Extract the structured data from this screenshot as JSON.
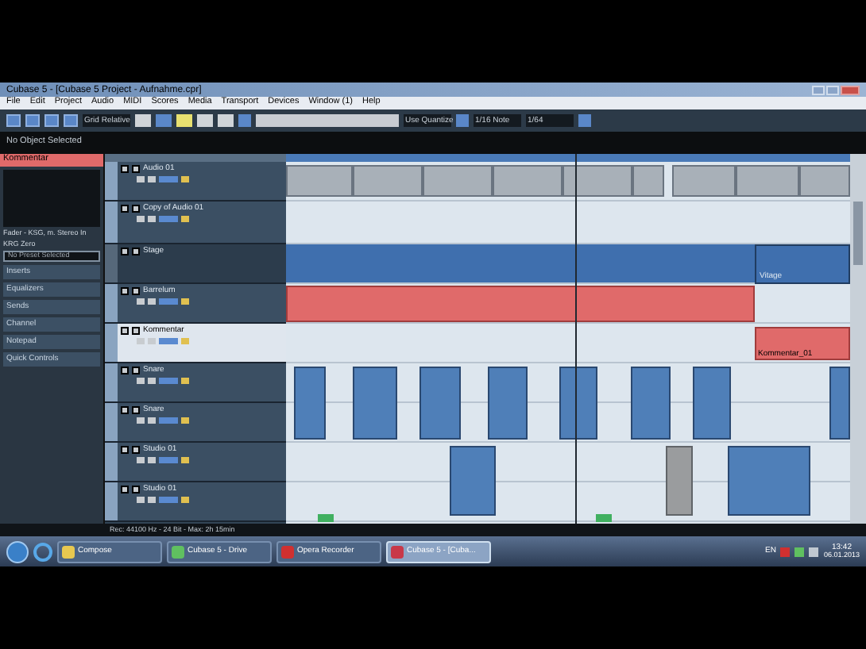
{
  "window": {
    "title": "Cubase 5 - [Cubase 5 Project - Aufnahme.cpr]"
  },
  "menu": [
    "File",
    "Edit",
    "Project",
    "Audio",
    "MIDI",
    "Scores",
    "Media",
    "Transport",
    "Devices",
    "Window (1)",
    "Help"
  ],
  "toolbar": {
    "mode": "Grid Relative",
    "quantize": "1/16 Note",
    "snap": "Use Quantize",
    "zoom": "1/64"
  },
  "info_line": "No Object Selected",
  "inspector": {
    "track_name": "Kommentar",
    "sends_note": "Fader - KSG, m. Stereo In",
    "sub_note": "KRG Zero",
    "search": "No Preset Selected",
    "sections": [
      {
        "label": "Inserts"
      },
      {
        "label": "Equalizers"
      },
      {
        "label": "Sends"
      },
      {
        "label": "Channel"
      },
      {
        "label": "Notepad"
      },
      {
        "label": "Quick Controls"
      }
    ]
  },
  "tracks": [
    {
      "name": "Audio 01",
      "kind": "audio",
      "selected": false
    },
    {
      "name": "Copy of Audio 01",
      "kind": "audio",
      "selected": false
    },
    {
      "name": "Stage",
      "kind": "folder",
      "selected": false
    },
    {
      "name": "Barrelum",
      "kind": "midi",
      "selected": false
    },
    {
      "name": "Kommentar",
      "kind": "midi",
      "selected": true
    },
    {
      "name": "Snare",
      "kind": "midi",
      "selected": false
    },
    {
      "name": "Snare",
      "kind": "midi",
      "selected": false
    },
    {
      "name": "Studio 01",
      "kind": "midi",
      "selected": false
    },
    {
      "name": "Studio 01",
      "kind": "midi",
      "selected": false
    }
  ],
  "part_labels": [
    "Vitage",
    "Kommentar_01"
  ],
  "status_bar": "Rec: 44100 Hz - 24 Bit - Max: 2h 15min",
  "taskbar": [
    {
      "label": "Compose",
      "selected": false
    },
    {
      "label": "Cubase 5 - Drive",
      "selected": false
    },
    {
      "label": "Opera Recorder",
      "selected": false
    },
    {
      "label": "Cubase 5 - [Cuba...",
      "selected": true
    }
  ],
  "tray": {
    "lang": "EN",
    "time": "13:42",
    "date": "06.01.2013"
  }
}
